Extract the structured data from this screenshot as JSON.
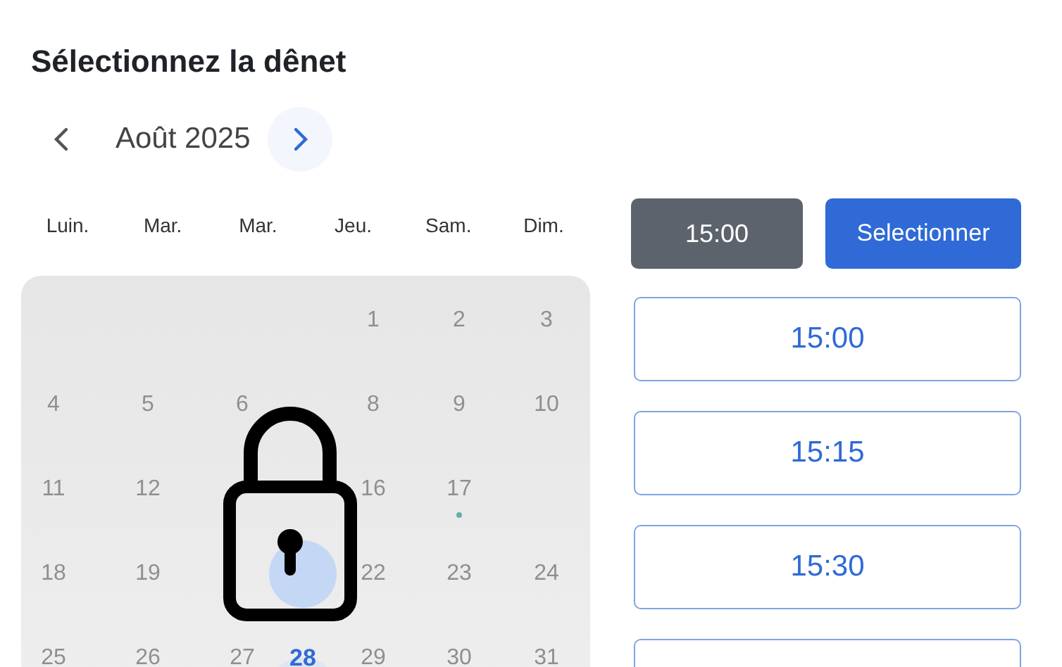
{
  "title": "Sélectionnez la dênet",
  "month": {
    "label": "Août 2025"
  },
  "weekdays": [
    "Luin.",
    "Mar.",
    "Mar.",
    "Jeu.",
    "Sam.",
    "Dim."
  ],
  "weeks": [
    [
      {
        "kind": "blank"
      },
      {
        "kind": "blank"
      },
      {
        "kind": "blank"
      },
      {
        "kind": "blank"
      },
      {
        "kind": "day",
        "day": "1",
        "selected": false,
        "today": false,
        "dot": false
      },
      {
        "kind": "day",
        "day": "2",
        "selected": false,
        "today": false,
        "dot": false
      },
      {
        "kind": "day",
        "day": "3",
        "selected": false,
        "today": false,
        "dot": false
      }
    ],
    [
      {
        "kind": "day",
        "day": "4",
        "selected": false,
        "today": false,
        "dot": false
      },
      {
        "kind": "day",
        "day": "5",
        "selected": false,
        "today": false,
        "dot": false
      },
      {
        "kind": "day",
        "day": "6",
        "selected": false,
        "today": false,
        "dot": false
      },
      {
        "kind": "blank"
      },
      {
        "kind": "day",
        "day": "8",
        "selected": false,
        "today": false,
        "dot": false
      },
      {
        "kind": "day",
        "day": "9",
        "selected": false,
        "today": false,
        "dot": false
      },
      {
        "kind": "day",
        "day": "10",
        "selected": false,
        "today": false,
        "dot": false
      }
    ],
    [
      {
        "kind": "day",
        "day": "11",
        "selected": false,
        "today": false,
        "dot": false
      },
      {
        "kind": "day",
        "day": "12",
        "selected": false,
        "today": false,
        "dot": false
      },
      {
        "kind": "blank"
      },
      {
        "kind": "blank"
      },
      {
        "kind": "day",
        "day": "16",
        "selected": false,
        "today": false,
        "dot": false
      },
      {
        "kind": "day",
        "day": "17",
        "selected": false,
        "today": false,
        "dot": true
      },
      {
        "kind": "blank"
      }
    ],
    [
      {
        "kind": "day",
        "day": "18",
        "selected": false,
        "today": false,
        "dot": false
      },
      {
        "kind": "day",
        "day": "19",
        "selected": false,
        "today": false,
        "dot": false
      },
      {
        "kind": "blank"
      },
      {
        "kind": "covered",
        "selected": true
      },
      {
        "kind": "day",
        "day": "22",
        "selected": false,
        "today": false,
        "dot": false
      },
      {
        "kind": "day",
        "day": "23",
        "selected": false,
        "today": false,
        "dot": false
      },
      {
        "kind": "day",
        "day": "24",
        "selected": false,
        "today": false,
        "dot": false
      }
    ],
    [
      {
        "kind": "day",
        "day": "25",
        "selected": false,
        "today": false,
        "dot": false
      },
      {
        "kind": "day",
        "day": "26",
        "selected": false,
        "today": false,
        "dot": false
      },
      {
        "kind": "day",
        "day": "27",
        "selected": false,
        "today": false,
        "dot": false
      },
      {
        "kind": "day",
        "day": "28",
        "selected": false,
        "today": true,
        "dot": false
      },
      {
        "kind": "day",
        "day": "29",
        "selected": false,
        "today": false,
        "dot": false
      },
      {
        "kind": "day",
        "day": "30",
        "selected": false,
        "today": false,
        "dot": false
      },
      {
        "kind": "day",
        "day": "31",
        "selected": false,
        "today": false,
        "dot": false
      }
    ]
  ],
  "chosen_time": "15:00",
  "select_button": "Selectionner",
  "slots": [
    {
      "time": "15:00",
      "selected": false
    },
    {
      "time": "15:15",
      "selected": false
    },
    {
      "time": "15:30",
      "selected": false
    },
    {
      "selected": false
    }
  ]
}
